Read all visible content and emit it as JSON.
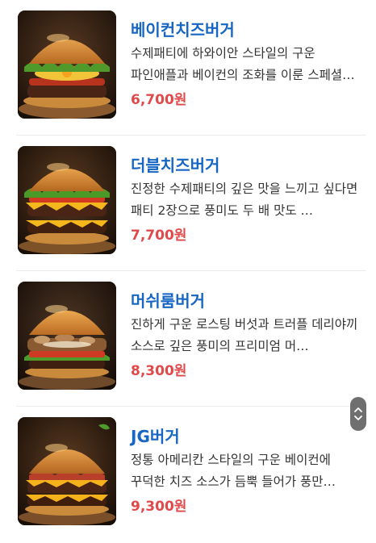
{
  "menu": {
    "currency_suffix": "원",
    "items": [
      {
        "name": "베이컨치즈버거",
        "description": "수제패티에 하와이안 스타일의 구운 파인애플과 베이컨의 조화를 이룬 스페셜…",
        "price": "6,700원",
        "image_icon": "bacon-cheese-burger-photo"
      },
      {
        "name": "더블치즈버거",
        "description": "진정한 수제패티의 깊은 맛을 느끼고 싶다면 패티 2장으로 풍미도 두 배 맛도 …",
        "price": "7,700원",
        "image_icon": "double-cheese-burger-photo"
      },
      {
        "name": "머쉬룸버거",
        "description": "진하게 구운 로스팅 버섯과 트러플 데리야끼 소스로 깊은 풍미의 프리미엄 머…",
        "price": "8,300원",
        "image_icon": "mushroom-burger-photo"
      },
      {
        "name": "JG버거",
        "description": "정통 아메리칸 스타일의 구운 베이컨에 꾸덕한 치즈 소스가 듬뿍 들어가 풍만…",
        "price": "9,300원",
        "image_icon": "jg-burger-photo"
      }
    ]
  },
  "scroll_control": {
    "up_icon": "chevron-up-icon",
    "down_icon": "chevron-down-icon"
  },
  "colors": {
    "name": "#1766c4",
    "price": "#e0494a",
    "description": "#333333",
    "divider": "#ececec"
  }
}
